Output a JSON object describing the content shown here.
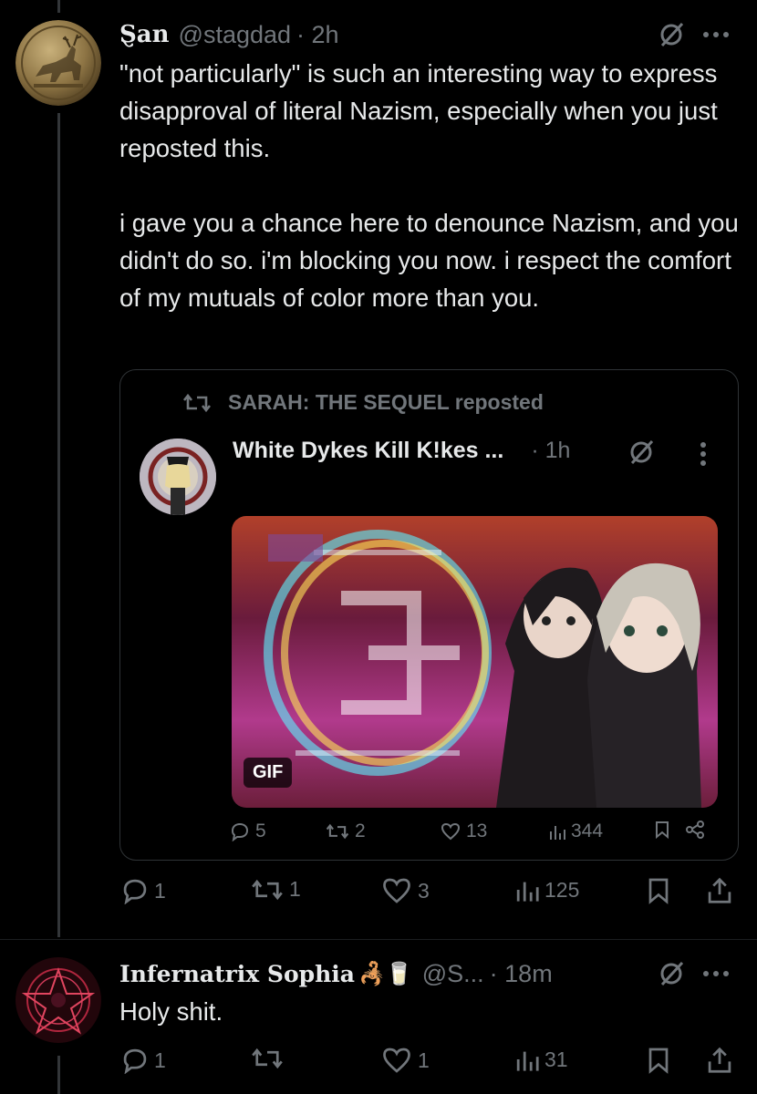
{
  "post1": {
    "display_name": "Ȿan",
    "handle": "@stagdad",
    "time": "· 2h",
    "text_p1": "\"not particularly\" is such an interesting way to express disapproval of literal Nazism, especially when you just reposted this.",
    "text_p2": "i gave you a chance here to denounce Nazism, and you didn't do so. i'm blocking you now. i respect the comfort of my mutuals of color more than you.",
    "actions": {
      "replies": "1",
      "reposts": "1",
      "likes": "3",
      "views": "125"
    }
  },
  "quote": {
    "repost_label": "SARAH: THE SEQUEL reposted",
    "display_name": "White Dykes Kill K!kes ...",
    "time": "· 1h",
    "media_badge": "GIF",
    "actions": {
      "replies": "5",
      "reposts": "2",
      "likes": "13",
      "views": "344"
    }
  },
  "post2": {
    "display_name": "Infernatrix Sophia",
    "emoji": "🦂🥛",
    "handle": "@S...",
    "time": "· 18m",
    "text": "Holy shit.",
    "actions": {
      "replies": "1",
      "reposts": "",
      "likes": "1",
      "views": "31"
    }
  },
  "colors": {
    "background": "#000000",
    "text": "#e7e9ea",
    "muted": "#71767b",
    "border": "#2f3336"
  }
}
